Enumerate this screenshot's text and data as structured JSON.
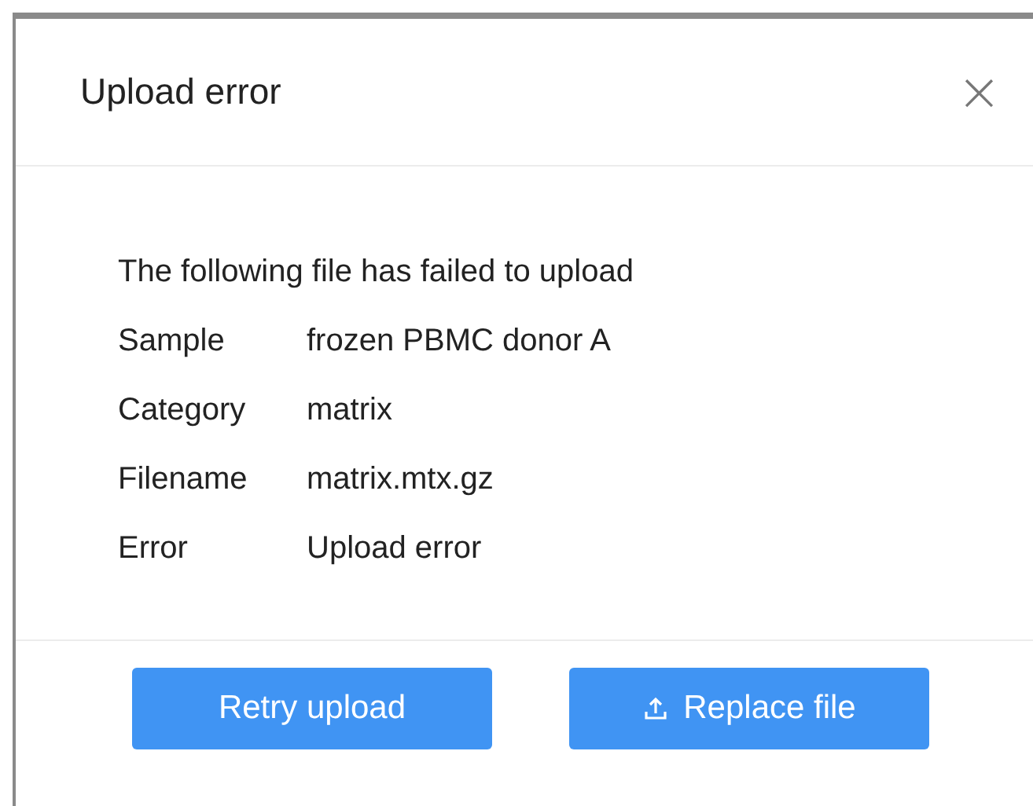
{
  "dialog": {
    "title": "Upload error",
    "close": "×"
  },
  "message": "The following file has failed to upload",
  "details": [
    {
      "label": "Sample",
      "value": "frozen PBMC donor A"
    },
    {
      "label": "Category",
      "value": "matrix"
    },
    {
      "label": "Filename",
      "value": "matrix.mtx.gz"
    },
    {
      "label": "Error",
      "value": "Upload error"
    }
  ],
  "buttons": [
    {
      "label": "Retry upload",
      "kind": "plain"
    },
    {
      "label": "Replace file",
      "kind": "upload"
    }
  ]
}
